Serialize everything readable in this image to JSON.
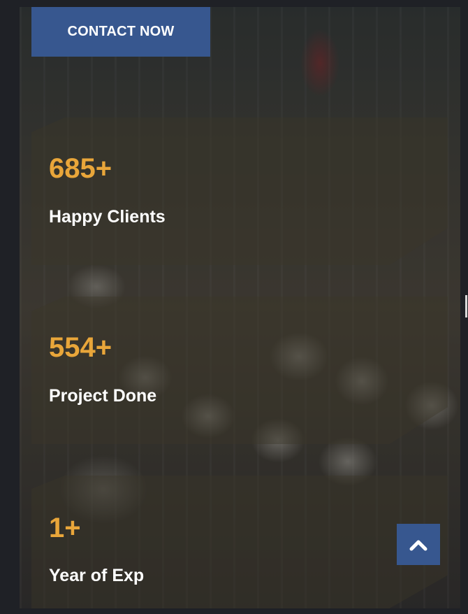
{
  "contact_button": {
    "label": "CONTACT NOW"
  },
  "stats": [
    {
      "value": "685+",
      "label": "Happy Clients"
    },
    {
      "value": "554+",
      "label": "Project Done"
    },
    {
      "value": "1+",
      "label": "Year of Exp"
    }
  ],
  "scroll_top": {
    "icon": "chevron-up-icon"
  },
  "colors": {
    "accent": "#e9a63a",
    "button": "#37578f",
    "text": "#ffffff"
  }
}
